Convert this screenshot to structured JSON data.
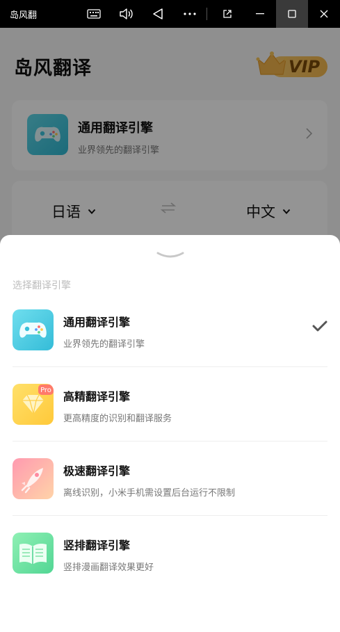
{
  "window": {
    "title": "岛风翻",
    "controls": [
      "keyboard-icon",
      "volume-icon",
      "back-icon",
      "more-icon",
      "external-icon",
      "minimize-icon",
      "maximize-icon",
      "close-icon"
    ]
  },
  "app": {
    "brand": "岛风翻译",
    "vip_label": "VIP",
    "current_engine": {
      "name": "通用翻译引擎",
      "description": "业界领先的翻译引擎"
    },
    "languages": {
      "source": "日语",
      "target": "中文",
      "swap_icon": "swap-arrows-icon"
    }
  },
  "sheet": {
    "title": "选择翻译引擎",
    "options": [
      {
        "name": "通用翻译引擎",
        "description": "业界领先的翻译引擎",
        "icon": "gamepad-icon",
        "selected": true
      },
      {
        "name": "高精翻译引擎",
        "description": "更高精度的识别和翻译服务",
        "icon": "diamond-pro-icon",
        "badge": "Pro",
        "selected": false
      },
      {
        "name": "极速翻译引擎",
        "description": "离线识别，小米手机需设置后台运行不限制",
        "icon": "rocket-icon",
        "selected": false
      },
      {
        "name": "竖排翻译引擎",
        "description": "竖排漫画翻译效果更好",
        "icon": "book-icon",
        "selected": false
      }
    ]
  },
  "colors": {
    "titlebar": "#000000",
    "vip_gold": "#f3b74d",
    "check": "#555555"
  }
}
